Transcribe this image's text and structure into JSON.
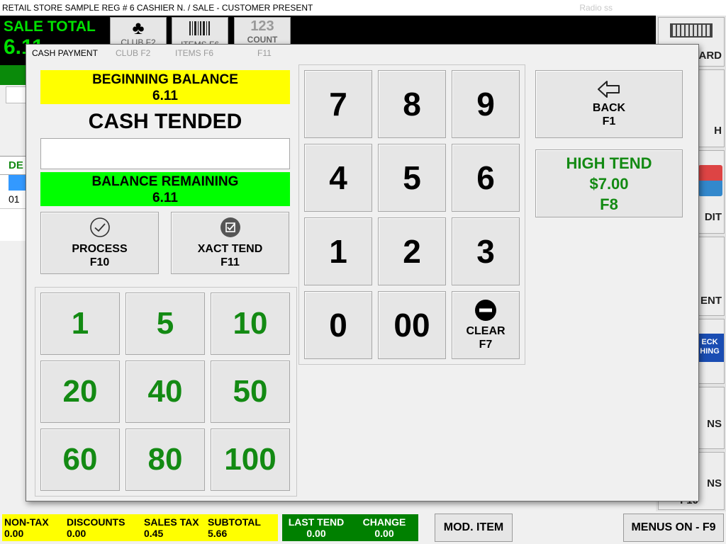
{
  "window": {
    "title": "RETAIL STORE SAMPLE REG # 6 CASHIER N. /  SALE - CUSTOMER PRESENT",
    "ghost_right": "Radio ss"
  },
  "background": {
    "sale_total_label": "SALE TOTAL",
    "sale_total_value": "6.11",
    "toolbar": [
      {
        "label": "CLUB F2",
        "icon": "club-icon"
      },
      {
        "label": "ITEMS F6",
        "icon": "barcode-icon"
      },
      {
        "label": "COUNT",
        "icon": "count-icon",
        "icon_text": "123"
      }
    ],
    "right_buttons": [
      "KEYBOARD",
      "H",
      "DIT",
      "ENT",
      "NS",
      "NS",
      "F10"
    ],
    "right_badge": "ECK HING",
    "table_header": "DE",
    "table_row": "01"
  },
  "modal": {
    "title": "CASH PAYMENT",
    "ghost_tabs": [
      "CLUB F2",
      "ITEMS F6",
      "F11"
    ],
    "beginning_balance_label": "BEGINNING BALANCE",
    "beginning_balance_value": "6.11",
    "cash_tended_label": "CASH TENDED",
    "cash_tended_value": "",
    "balance_remaining_label": "BALANCE REMAINING",
    "balance_remaining_value": "6.11",
    "process": {
      "label": "PROCESS",
      "key": "F10"
    },
    "xact_tend": {
      "label": "XACT TEND",
      "key": "F11"
    },
    "quick_cash": [
      "1",
      "5",
      "10",
      "20",
      "40",
      "50",
      "60",
      "80",
      "100"
    ],
    "keypad": [
      "7",
      "8",
      "9",
      "4",
      "5",
      "6",
      "1",
      "2",
      "3",
      "0",
      "00"
    ],
    "clear": {
      "label": "CLEAR",
      "key": "F7"
    },
    "back": {
      "label": "BACK",
      "key": "F1"
    },
    "high_tend": {
      "label": "HIGH TEND",
      "amount": "$7.00",
      "key": "F8"
    }
  },
  "status": {
    "non_tax_label": "NON-TAX",
    "non_tax_value": "0.00",
    "discounts_label": "DISCOUNTS",
    "discounts_value": "0.00",
    "sales_tax_label": "SALES TAX",
    "sales_tax_value": "0.45",
    "subtotal_label": "SUBTOTAL",
    "subtotal_value": "5.66",
    "last_tend_label": "LAST TEND",
    "last_tend_value": "0.00",
    "change_label": "CHANGE",
    "change_value": "0.00",
    "mod_item_button": "MOD. ITEM",
    "menus_on_button": "MENUS ON - F9"
  },
  "colors": {
    "cash_green": "#138a13",
    "balance_yellow": "#ffff00",
    "remaining_green": "#00ff00",
    "sale_total_green": "#00e000"
  }
}
